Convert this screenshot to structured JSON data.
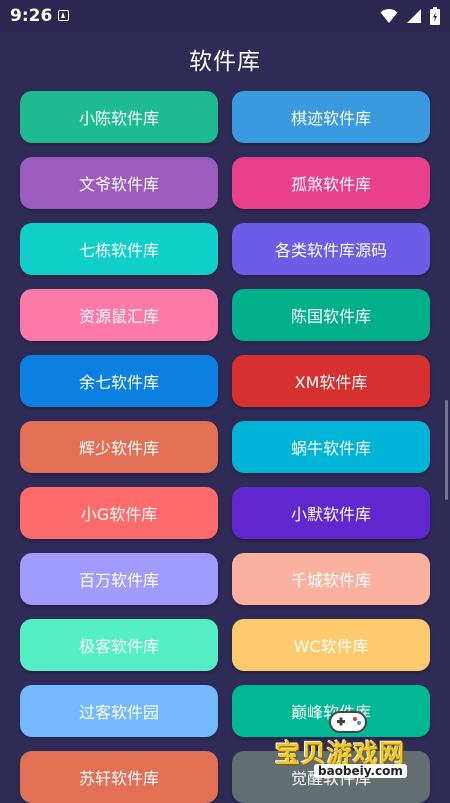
{
  "status_bar": {
    "time": "9:26",
    "icons": [
      "app-notification-icon",
      "wifi-icon",
      "signal-icon",
      "battery-icon"
    ]
  },
  "header": {
    "title": "软件库"
  },
  "buttons": [
    {
      "label": "小陈软件库",
      "color": "#1ebb91"
    },
    {
      "label": "棋迹软件库",
      "color": "#3a9ae0"
    },
    {
      "label": "文爷软件库",
      "color": "#9c5cbf"
    },
    {
      "label": "孤煞软件库",
      "color": "#e8408c"
    },
    {
      "label": "七栋软件库",
      "color": "#10cfc9"
    },
    {
      "label": "各类软件库源码",
      "color": "#6c5ce7"
    },
    {
      "label": "资源鼠汇库",
      "color": "#fd79a8"
    },
    {
      "label": "陈国软件库",
      "color": "#00b08a"
    },
    {
      "label": "余七软件库",
      "color": "#0c80e0"
    },
    {
      "label": "XM软件库",
      "color": "#d63031"
    },
    {
      "label": "辉少软件库",
      "color": "#e17055"
    },
    {
      "label": "蜗牛软件库",
      "color": "#00b4d8"
    },
    {
      "label": "小G软件库",
      "color": "#ff6b6b"
    },
    {
      "label": "小默软件库",
      "color": "#5f27cd"
    },
    {
      "label": "百万软件库",
      "color": "#a29bfe"
    },
    {
      "label": "千城软件库",
      "color": "#fab1a0"
    },
    {
      "label": "极客软件库",
      "color": "#55efc4"
    },
    {
      "label": "WC软件库",
      "color": "#fdcb6e"
    },
    {
      "label": "过客软件园",
      "color": "#74b9ff"
    },
    {
      "label": "巅峰软件库",
      "color": "#00b894"
    },
    {
      "label": "苏轩软件库",
      "color": "#e17055"
    },
    {
      "label": "觉醒软件库",
      "color": "#636e72"
    }
  ],
  "watermark": {
    "text": "宝贝游戏网",
    "url": "baobeiy.com"
  }
}
